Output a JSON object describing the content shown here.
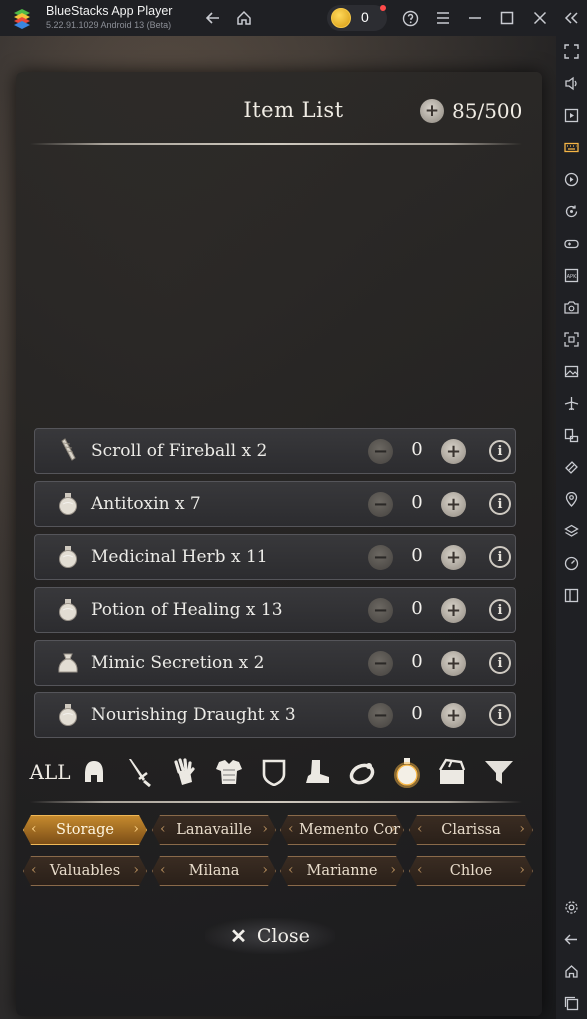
{
  "window": {
    "title": "BlueStacks App Player",
    "version": "5.22.91.1029  Android 13 (Beta)",
    "coins": "0",
    "icons": [
      "back-arrow-icon",
      "home-icon",
      "help-icon",
      "menu-icon",
      "minimize-icon",
      "maximize-icon",
      "close-icon",
      "collapse-sidebar-icon"
    ]
  },
  "sidebar": {
    "icons": [
      "fullscreen-icon",
      "volume-icon",
      "screen-record-icon",
      "keyboard-icon",
      "macro-icon",
      "rotate-icon",
      "gamepad-icon",
      "apk-icon",
      "screenshot-icon",
      "scan-icon",
      "media-icon",
      "airplane-icon",
      "multi-instance-icon",
      "eco-mode-icon",
      "location-icon",
      "layers-icon",
      "performance-icon",
      "sidebar-toggle-icon",
      "settings-icon",
      "back-icon",
      "home-icon",
      "recents-icon"
    ]
  },
  "panel": {
    "title": "Item List",
    "capacity": "85/500"
  },
  "items": [
    {
      "name": "Scroll of Fireball x 2",
      "qty": "0",
      "icon": "scroll-icon"
    },
    {
      "name": "Antitoxin x 7",
      "qty": "0",
      "icon": "flask-icon"
    },
    {
      "name": "Medicinal Herb x 11",
      "qty": "0",
      "icon": "flask-icon"
    },
    {
      "name": "Potion of Healing x 13",
      "qty": "0",
      "icon": "flask-icon"
    },
    {
      "name": "Mimic Secretion x 2",
      "qty": "0",
      "icon": "pouch-icon"
    },
    {
      "name": "Nourishing Draught x 3",
      "qty": "0",
      "icon": "flask-icon"
    }
  ],
  "filters": {
    "all_label": "ALL",
    "icons": [
      "helmet-icon",
      "sword-icon",
      "glove-icon",
      "armor-icon",
      "shield-icon",
      "boot-icon",
      "ring-icon",
      "potion-icon",
      "chest-icon",
      "filter-icon"
    ],
    "active": "potion-icon"
  },
  "tabs": {
    "row1": [
      "Storage",
      "Lanavaille",
      "Memento Cor",
      "Clarissa"
    ],
    "row2": [
      "Valuables",
      "Milana",
      "Marianne",
      "Chloe"
    ],
    "active": "Storage"
  },
  "close_label": "Close",
  "colors": {
    "accent": "#f6b545",
    "tab_active": "#c58a2e",
    "panel": "#2c2c2f"
  }
}
